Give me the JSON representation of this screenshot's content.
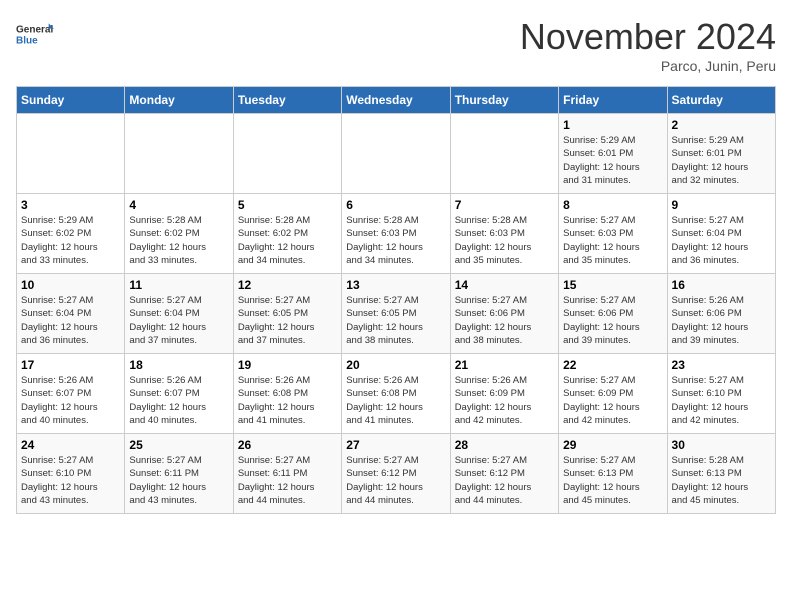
{
  "header": {
    "logo_general": "General",
    "logo_blue": "Blue",
    "month_title": "November 2024",
    "subtitle": "Parco, Junin, Peru"
  },
  "days_of_week": [
    "Sunday",
    "Monday",
    "Tuesday",
    "Wednesday",
    "Thursday",
    "Friday",
    "Saturday"
  ],
  "weeks": [
    [
      {
        "day": "",
        "info": ""
      },
      {
        "day": "",
        "info": ""
      },
      {
        "day": "",
        "info": ""
      },
      {
        "day": "",
        "info": ""
      },
      {
        "day": "",
        "info": ""
      },
      {
        "day": "1",
        "info": "Sunrise: 5:29 AM\nSunset: 6:01 PM\nDaylight: 12 hours\nand 31 minutes."
      },
      {
        "day": "2",
        "info": "Sunrise: 5:29 AM\nSunset: 6:01 PM\nDaylight: 12 hours\nand 32 minutes."
      }
    ],
    [
      {
        "day": "3",
        "info": "Sunrise: 5:29 AM\nSunset: 6:02 PM\nDaylight: 12 hours\nand 33 minutes."
      },
      {
        "day": "4",
        "info": "Sunrise: 5:28 AM\nSunset: 6:02 PM\nDaylight: 12 hours\nand 33 minutes."
      },
      {
        "day": "5",
        "info": "Sunrise: 5:28 AM\nSunset: 6:02 PM\nDaylight: 12 hours\nand 34 minutes."
      },
      {
        "day": "6",
        "info": "Sunrise: 5:28 AM\nSunset: 6:03 PM\nDaylight: 12 hours\nand 34 minutes."
      },
      {
        "day": "7",
        "info": "Sunrise: 5:28 AM\nSunset: 6:03 PM\nDaylight: 12 hours\nand 35 minutes."
      },
      {
        "day": "8",
        "info": "Sunrise: 5:27 AM\nSunset: 6:03 PM\nDaylight: 12 hours\nand 35 minutes."
      },
      {
        "day": "9",
        "info": "Sunrise: 5:27 AM\nSunset: 6:04 PM\nDaylight: 12 hours\nand 36 minutes."
      }
    ],
    [
      {
        "day": "10",
        "info": "Sunrise: 5:27 AM\nSunset: 6:04 PM\nDaylight: 12 hours\nand 36 minutes."
      },
      {
        "day": "11",
        "info": "Sunrise: 5:27 AM\nSunset: 6:04 PM\nDaylight: 12 hours\nand 37 minutes."
      },
      {
        "day": "12",
        "info": "Sunrise: 5:27 AM\nSunset: 6:05 PM\nDaylight: 12 hours\nand 37 minutes."
      },
      {
        "day": "13",
        "info": "Sunrise: 5:27 AM\nSunset: 6:05 PM\nDaylight: 12 hours\nand 38 minutes."
      },
      {
        "day": "14",
        "info": "Sunrise: 5:27 AM\nSunset: 6:06 PM\nDaylight: 12 hours\nand 38 minutes."
      },
      {
        "day": "15",
        "info": "Sunrise: 5:27 AM\nSunset: 6:06 PM\nDaylight: 12 hours\nand 39 minutes."
      },
      {
        "day": "16",
        "info": "Sunrise: 5:26 AM\nSunset: 6:06 PM\nDaylight: 12 hours\nand 39 minutes."
      }
    ],
    [
      {
        "day": "17",
        "info": "Sunrise: 5:26 AM\nSunset: 6:07 PM\nDaylight: 12 hours\nand 40 minutes."
      },
      {
        "day": "18",
        "info": "Sunrise: 5:26 AM\nSunset: 6:07 PM\nDaylight: 12 hours\nand 40 minutes."
      },
      {
        "day": "19",
        "info": "Sunrise: 5:26 AM\nSunset: 6:08 PM\nDaylight: 12 hours\nand 41 minutes."
      },
      {
        "day": "20",
        "info": "Sunrise: 5:26 AM\nSunset: 6:08 PM\nDaylight: 12 hours\nand 41 minutes."
      },
      {
        "day": "21",
        "info": "Sunrise: 5:26 AM\nSunset: 6:09 PM\nDaylight: 12 hours\nand 42 minutes."
      },
      {
        "day": "22",
        "info": "Sunrise: 5:27 AM\nSunset: 6:09 PM\nDaylight: 12 hours\nand 42 minutes."
      },
      {
        "day": "23",
        "info": "Sunrise: 5:27 AM\nSunset: 6:10 PM\nDaylight: 12 hours\nand 42 minutes."
      }
    ],
    [
      {
        "day": "24",
        "info": "Sunrise: 5:27 AM\nSunset: 6:10 PM\nDaylight: 12 hours\nand 43 minutes."
      },
      {
        "day": "25",
        "info": "Sunrise: 5:27 AM\nSunset: 6:11 PM\nDaylight: 12 hours\nand 43 minutes."
      },
      {
        "day": "26",
        "info": "Sunrise: 5:27 AM\nSunset: 6:11 PM\nDaylight: 12 hours\nand 44 minutes."
      },
      {
        "day": "27",
        "info": "Sunrise: 5:27 AM\nSunset: 6:12 PM\nDaylight: 12 hours\nand 44 minutes."
      },
      {
        "day": "28",
        "info": "Sunrise: 5:27 AM\nSunset: 6:12 PM\nDaylight: 12 hours\nand 44 minutes."
      },
      {
        "day": "29",
        "info": "Sunrise: 5:27 AM\nSunset: 6:13 PM\nDaylight: 12 hours\nand 45 minutes."
      },
      {
        "day": "30",
        "info": "Sunrise: 5:28 AM\nSunset: 6:13 PM\nDaylight: 12 hours\nand 45 minutes."
      }
    ]
  ]
}
